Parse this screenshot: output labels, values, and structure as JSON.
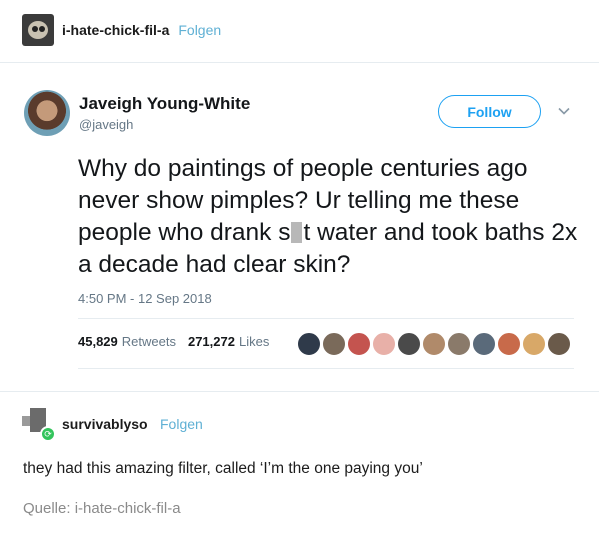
{
  "post": {
    "username": "i-hate-chick-fil-a",
    "follow_label": "Folgen"
  },
  "tweet": {
    "display_name": "Javeigh Young-White",
    "handle": "@javeigh",
    "follow_label": "Follow",
    "text_before_censor": "Why do paintings of people centuries ago never show pimples? Ur telling me these people who drank s",
    "text_after_censor": "t water and took baths 2x a decade had clear skin?",
    "timestamp": "4:50 PM - 12 Sep 2018",
    "retweets_count": "45,829",
    "retweets_label": "Retweets",
    "likes_count": "271,272",
    "likes_label": "Likes",
    "liker_colors": [
      "#2f3a4a",
      "#7a6a5a",
      "#c4544f",
      "#e8b0a8",
      "#4a4a4a",
      "#b08a6a",
      "#8a7a6a",
      "#5a6a7a",
      "#c86a4a",
      "#d8a868",
      "#6a5a4a"
    ]
  },
  "reblog": {
    "username": "survivablyso",
    "follow_label": "Folgen",
    "text": "they had this amazing filter, called ‘I’m the one paying you’"
  },
  "source": {
    "label": "Quelle:",
    "link": "i-hate-chick-fil-a"
  }
}
